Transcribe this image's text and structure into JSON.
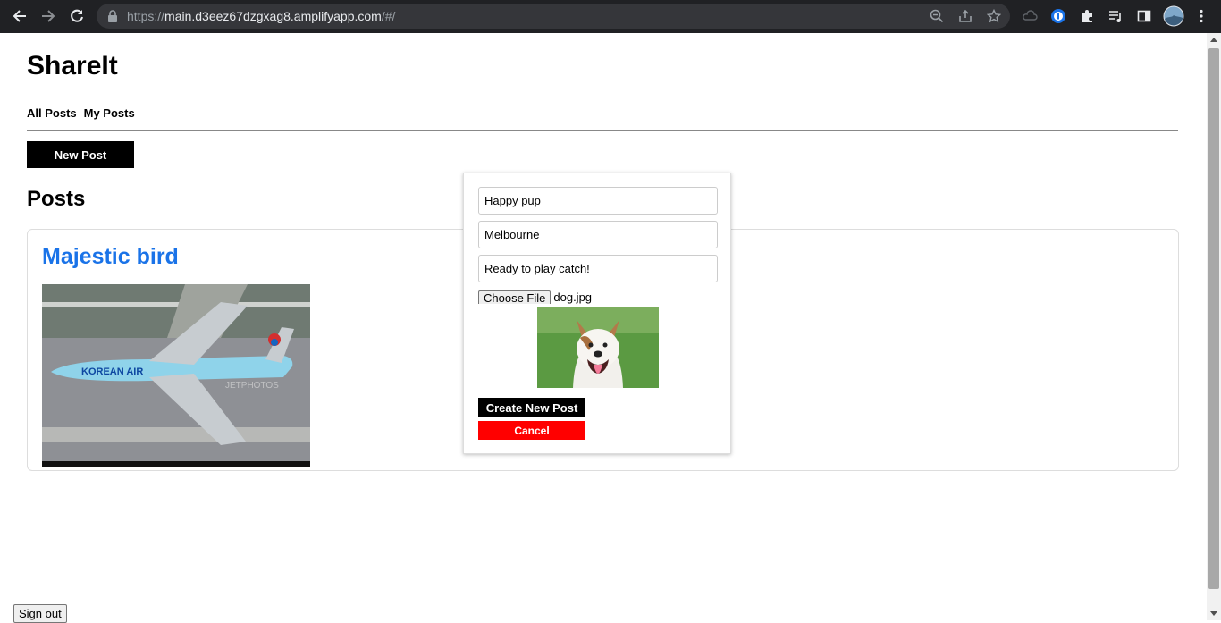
{
  "browser": {
    "url_prefix": "https://",
    "url_host": "main.d3eez67dzgxag8.amplifyapp.com",
    "url_path": "/#/"
  },
  "app": {
    "title": "ShareIt",
    "nav": [
      "All Posts",
      "My Posts"
    ],
    "new_post_label": "New Post",
    "posts_heading": "Posts",
    "sign_out_label": "Sign out"
  },
  "post": {
    "title": "Majestic bird",
    "image_caption_text": "KOREAN AIR",
    "watermark": "JETPHOTOS"
  },
  "modal": {
    "title_value": "Happy pup",
    "location_value": "Melbourne",
    "description_value": "Ready to play catch!",
    "choose_file_label": "Choose File",
    "file_name": "dog.jpg",
    "create_label": "Create New Post",
    "cancel_label": "Cancel"
  },
  "colors": {
    "link_blue": "#1a73e8",
    "cancel_red": "#ff0000",
    "button_black": "#000000"
  }
}
